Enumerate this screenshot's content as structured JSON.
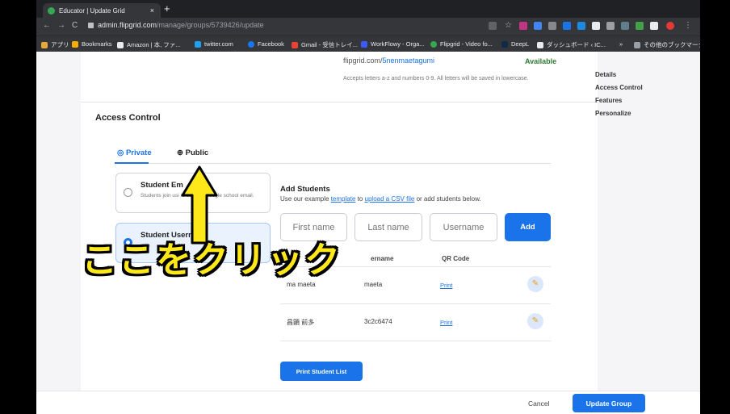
{
  "browser": {
    "tab_title": "Educator | Update Grid",
    "tab_close": "×",
    "new_tab": "+",
    "url_host": "admin.flipgrid.com",
    "url_path": "/manage/groups/5739426/update",
    "bookmarks": [
      "アプリ",
      "Bookmarks",
      "Amazon | 本, ファ...",
      "twitter.com",
      "Facebook",
      "Gmail - 受信トレイ...",
      "WorkFlowy - Orga...",
      "Flipgrid - Video fo...",
      "DeepL",
      "ダッシュボード ‹ IC...",
      "»",
      "その他のブックマーク"
    ]
  },
  "handle": {
    "prefix": "flipgrid.com/",
    "name": "5nenmaetagumi",
    "status": "Available",
    "hint": "Accepts letters a-z and numbers 0-9. All letters will be saved in lowercase."
  },
  "sidebar": [
    "Details",
    "Access Control",
    "Features",
    "Personalize"
  ],
  "access_control": {
    "heading": "Access Control",
    "tabs": {
      "private": "Private",
      "public": "Public"
    },
    "options": [
      {
        "title": "Student Em",
        "desc": "Students join usi          icrosoft or Google school email."
      },
      {
        "title": "Student Username",
        "desc": "                    with"
      }
    ]
  },
  "add_students": {
    "title": "Add Students",
    "sub_prefix": "Use our example ",
    "template_link": "template",
    "sub_mid": " to ",
    "csv_link": "upload a CSV file",
    "sub_suffix": " or add students below.",
    "placeholders": {
      "first": "First name",
      "last": "Last name",
      "username": "Username"
    },
    "add_label": "Add",
    "headers": [
      "S",
      "ername",
      "QR Code"
    ],
    "rows": [
      {
        "name": "ma         maeta",
        "username": "maeta",
        "qr": "Print"
      },
      {
        "name": "昌顕 前多",
        "username": "3c2c6474",
        "qr": "Print"
      }
    ],
    "print_list": "Print Student List"
  },
  "footer": {
    "cancel": "Cancel",
    "update": "Update Group"
  },
  "overlay": {
    "text": "ここをクリック"
  }
}
